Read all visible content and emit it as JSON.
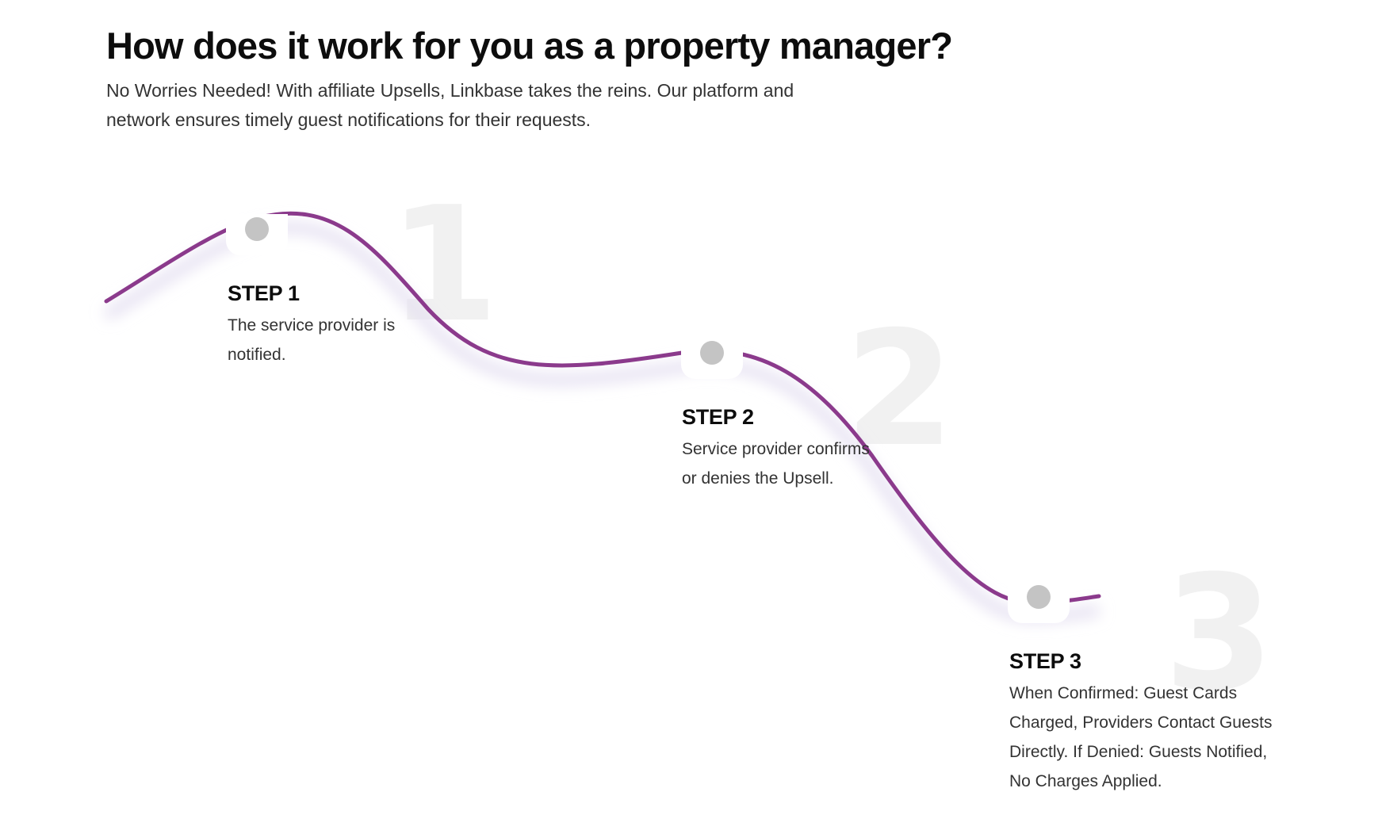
{
  "section": {
    "heading": "How does it work for you as a property manager?",
    "intro": "No Worries Needed! With affiliate Upsells, Linkbase takes the reins. Our platform and network ensures timely guest notifications for their requests."
  },
  "steps": [
    {
      "number": "1",
      "title": "STEP 1",
      "description": "The service provider is notified."
    },
    {
      "number": "2",
      "title": "STEP 2",
      "description": "Service provider confirms or denies the Upsell."
    },
    {
      "number": "3",
      "title": "STEP 3",
      "description": "When Confirmed: Guest Cards Charged, Providers Contact Guests Directly. If Denied: Guests Notified, No Charges Applied."
    }
  ],
  "colors": {
    "curve": "#8b3a8c",
    "dot": "#c4c4c4",
    "big_number": "#f1f1f1"
  }
}
